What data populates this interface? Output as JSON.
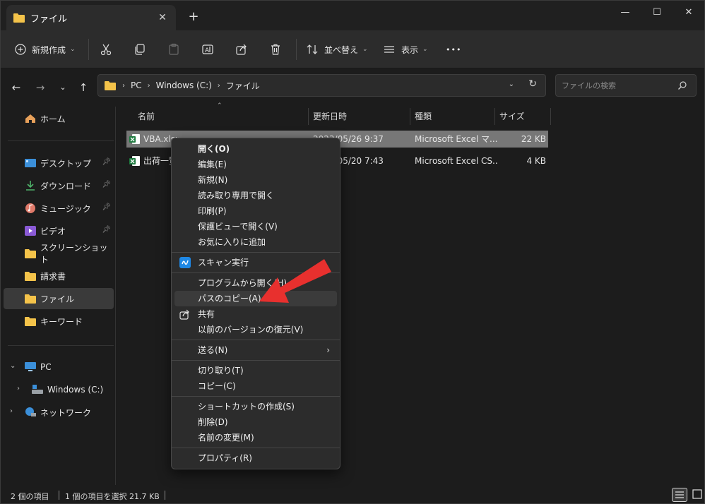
{
  "window": {
    "tab_title": "ファイル",
    "tab_close": "✕",
    "new_tab": "+",
    "minimize": "—",
    "maximize": "☐",
    "close": "✕"
  },
  "toolbar": {
    "new_label": "新規作成",
    "sort_label": "並べ替え",
    "view_label": "表示",
    "more": "•••"
  },
  "address": {
    "crumbs": [
      "PC",
      "Windows (C:)",
      "ファイル"
    ],
    "search_placeholder": "ファイルの検索"
  },
  "sidebar": {
    "home": "ホーム",
    "quick": [
      {
        "label": "デスクトップ",
        "icon": "desktop-icon"
      },
      {
        "label": "ダウンロード",
        "icon": "download-icon"
      },
      {
        "label": "ミュージック",
        "icon": "music-icon"
      },
      {
        "label": "ビデオ",
        "icon": "video-icon"
      },
      {
        "label": "スクリーンショット",
        "icon": "folder-icon"
      },
      {
        "label": "請求書",
        "icon": "folder-icon"
      },
      {
        "label": "ファイル",
        "icon": "folder-icon"
      },
      {
        "label": "キーワード",
        "icon": "folder-icon"
      }
    ],
    "pc": "PC",
    "drive": "Windows (C:)",
    "network": "ネットワーク"
  },
  "columns": {
    "name": "名前",
    "date": "更新日時",
    "type": "種類",
    "size": "サイズ"
  },
  "files": [
    {
      "name": "VBA.xlsx",
      "date": "2023/05/26 9:37",
      "type": "Microsoft Excel マ...",
      "size": "22 KB"
    },
    {
      "name": "出荷一覧",
      "date": "2023/05/20 7:43",
      "type": "Microsoft Excel CS...",
      "size": "4 KB"
    }
  ],
  "context_menu": {
    "open": "開く(O)",
    "edit": "編集(E)",
    "new": "新規(N)",
    "open_readonly": "読み取り専用で開く",
    "print": "印刷(P)",
    "protected_view": "保護ビューで開く(V)",
    "add_favorite": "お気に入りに追加",
    "scan": "スキャン実行",
    "open_with": "プログラムから開く(H)",
    "copy_path": "パスのコピー(A)",
    "share": "共有",
    "restore_prev": "以前のバージョンの復元(V)",
    "send_to": "送る(N)",
    "cut": "切り取り(T)",
    "copy": "コピー(C)",
    "create_shortcut": "ショートカットの作成(S)",
    "delete": "削除(D)",
    "rename": "名前の変更(M)",
    "properties": "プロパティ(R)"
  },
  "status": {
    "count": "2 個の項目",
    "selected": "1 個の項目を選択  21.7 KB"
  },
  "colors": {
    "accent_red": "#e8302e",
    "excel_green": "#1d7a3e",
    "folder_yellow": "#f4c34a",
    "selected_row": "#777777"
  }
}
